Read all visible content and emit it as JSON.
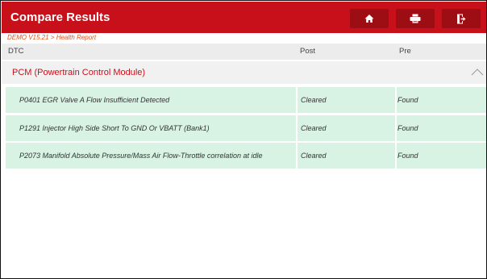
{
  "header": {
    "title": "Compare Results",
    "accent_color": "#c8101a",
    "buttons": [
      {
        "icon": "home-icon"
      },
      {
        "icon": "print-icon"
      },
      {
        "icon": "exit-icon"
      }
    ]
  },
  "breadcrumb": "DEMO V15.21 > Health Report",
  "table": {
    "columns": [
      "DTC",
      "Post",
      "Pre"
    ],
    "group": {
      "label": "PCM (Powertrain Control Module)",
      "expanded": true,
      "icon": "chevron-up-icon"
    },
    "rows": [
      {
        "dtc": "P0401 EGR Valve A Flow Insufficient Detected",
        "post": "Cleared",
        "pre": "Found"
      },
      {
        "dtc": "P1291 Injector High Side Short To GND Or VBATT (Bank1)",
        "post": "Cleared",
        "pre": "Found"
      },
      {
        "dtc": "P2073 Manifold Absolute Pressure/Mass Air Flow-Throttle correlation at idle",
        "post": "Cleared",
        "pre": "Found"
      }
    ]
  }
}
